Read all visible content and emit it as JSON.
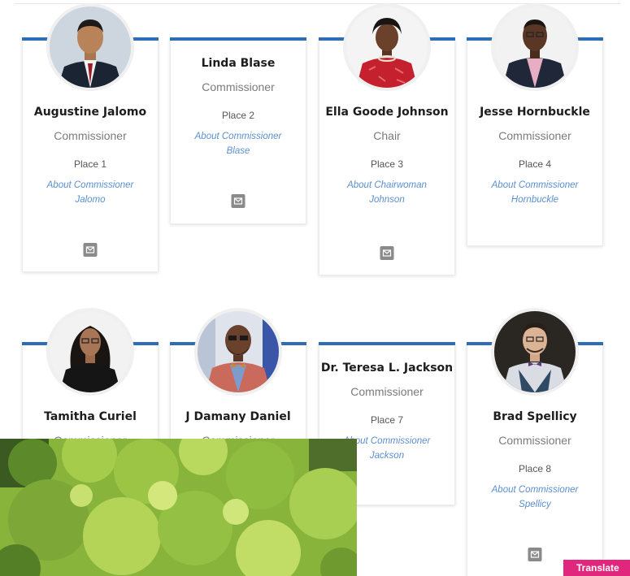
{
  "commissioners": [
    {
      "name": "Augustine Jalomo",
      "role": "Commissioner",
      "place": "Place 1",
      "about_line1": "About Commissioner",
      "about_line2": "Jalomo",
      "email_icon": "envelope-icon"
    },
    {
      "name": "Linda Blase",
      "role": "Commissioner",
      "place": "Place 2",
      "about_line1": "About Commissioner",
      "about_line2": "Blase",
      "email_icon": "envelope-icon"
    },
    {
      "name": "Ella Goode Johnson",
      "role": "Chair",
      "place": "Place 3",
      "about_line1": "About Chairwoman",
      "about_line2": "Johnson",
      "email_icon": "envelope-icon"
    },
    {
      "name": "Jesse Hornbuckle",
      "role": "Commissioner",
      "place": "Place 4",
      "about_line1": "About Commissioner",
      "about_line2": "Hornbuckle"
    },
    {
      "name": "Tamitha Curiel",
      "role": "Commissioner"
    },
    {
      "name": "J Damany Daniel",
      "role": "Commissioner"
    },
    {
      "name": "Dr. Teresa L. Jackson",
      "role": "Commissioner",
      "place": "Place 7",
      "about_line1": "About Commissioner",
      "about_line2": "Jackson"
    },
    {
      "name": "Brad Spellicy",
      "role": "Commissioner",
      "place": "Place 8",
      "about_line1": "About Commissioner",
      "about_line2": "Spellicy",
      "email_icon": "envelope-icon"
    }
  ],
  "translate_button": {
    "label": "Translate"
  },
  "colors": {
    "accent_bar": "#2f6db5",
    "link": "#5b8fcf",
    "translate_bg": "#e0267d",
    "mail_icon_bg": "#8a8a8a"
  }
}
